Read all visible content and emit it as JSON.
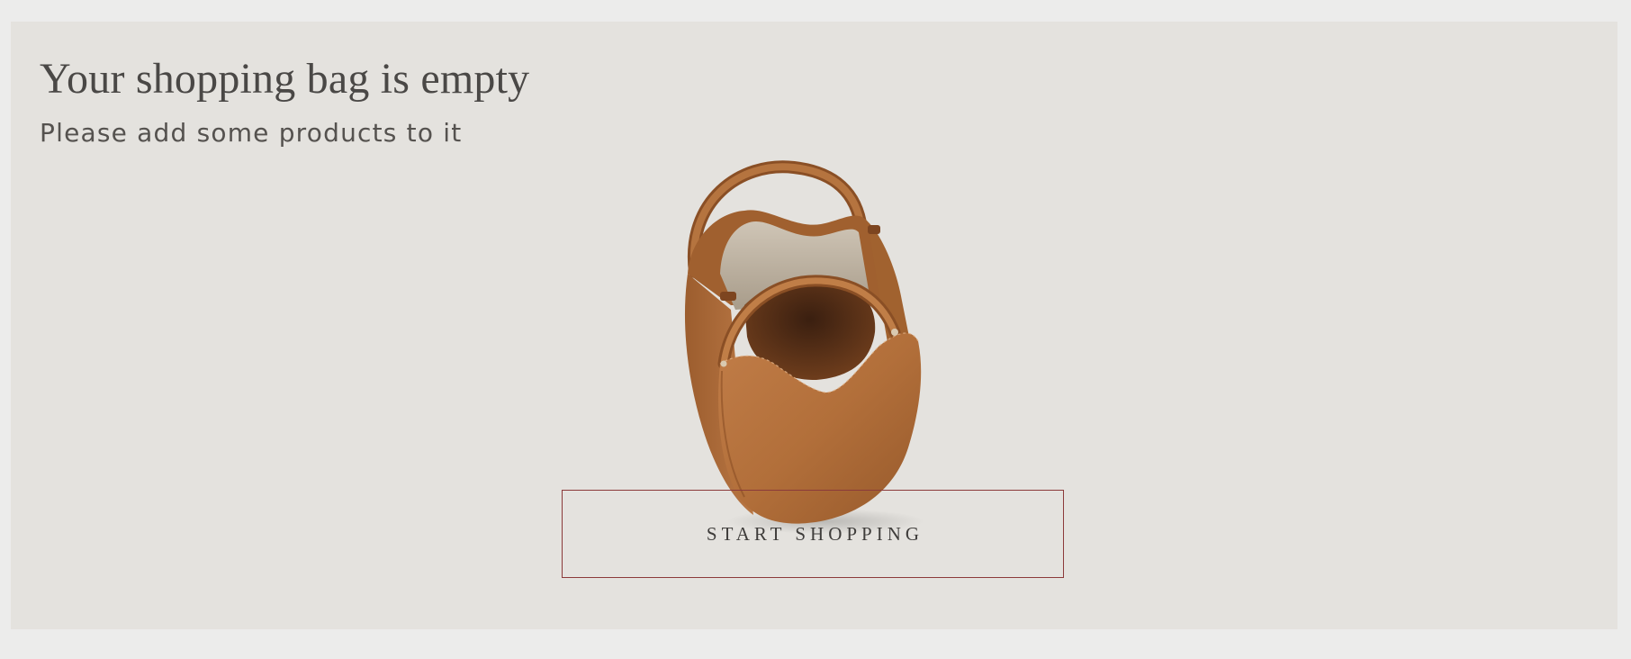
{
  "empty_bag": {
    "title": "Your shopping bag is empty",
    "subtitle": "Please add some products to it",
    "cta_label": "START SHOPPING",
    "image_icon": "leather-bucket-bag-image"
  },
  "colors": {
    "page_background": "#ececeb",
    "panel_background": "#e4e2de",
    "button_border": "#8b3a3a",
    "text": "#4a4846",
    "leather": "#b06e3c"
  }
}
